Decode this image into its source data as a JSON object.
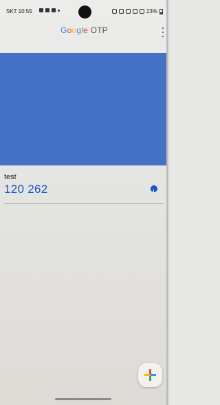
{
  "status_bar": {
    "carrier_time": "SKT 10:55",
    "battery": "23%"
  },
  "app_bar": {
    "title_google": [
      "G",
      "o",
      "o",
      "g",
      "l",
      "e"
    ],
    "title_suffix": " OTP"
  },
  "accounts": [
    {
      "issuer": "test",
      "code": "120 262"
    }
  ],
  "icons": {
    "menu": "more-vert-icon",
    "timer": "countdown-pie-icon",
    "add": "plus-icon"
  },
  "colors": {
    "banner": "#4472c4",
    "code": "#1a57c6"
  }
}
